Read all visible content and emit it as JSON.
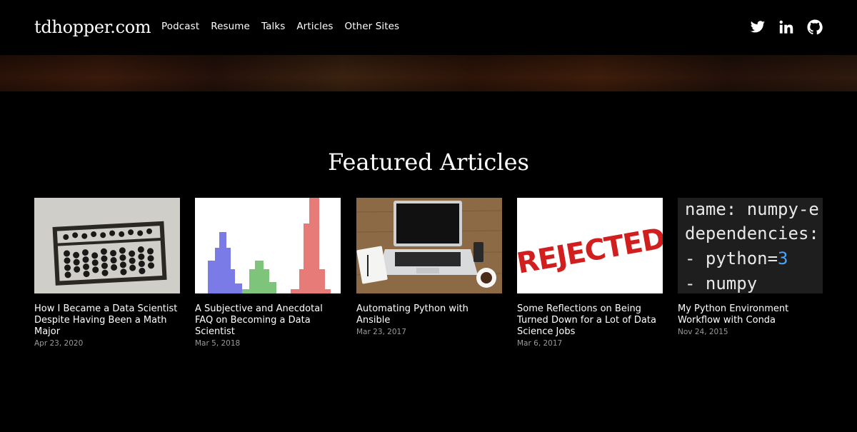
{
  "header": {
    "brand": "tdhopper.com",
    "nav": [
      "Podcast",
      "Resume",
      "Talks",
      "Articles",
      "Other Sites"
    ],
    "social_icons": [
      "twitter-icon",
      "linkedin-icon",
      "github-icon"
    ]
  },
  "featured": {
    "title": "Featured Articles",
    "articles": [
      {
        "title": "How I Became a Data Scientist Despite Having Been a Math Major",
        "date": "Apr 23, 2020",
        "image": "abacus"
      },
      {
        "title": "A Subjective and Anecdotal FAQ on Becoming a Data Scientist",
        "date": "Mar 5, 2018",
        "image": "histogram"
      },
      {
        "title": "Automating Python with Ansible",
        "date": "Mar 23, 2017",
        "image": "laptop-desk"
      },
      {
        "title": "Some Reflections on Being Turned Down for a Lot of Data Science Jobs",
        "date": "Mar 6, 2017",
        "image": "rejected-stamp"
      },
      {
        "title": "My Python Environment Workflow with Conda",
        "date": "Nov 24, 2015",
        "image": "code-yaml",
        "code": [
          "name: numpy-e",
          "dependencies:",
          "- python=3",
          "- numpy"
        ]
      }
    ]
  },
  "colors": {
    "background": "#000000",
    "text": "#ffffff",
    "date": "#9a9a9a",
    "banner": "#3a1a0c"
  }
}
